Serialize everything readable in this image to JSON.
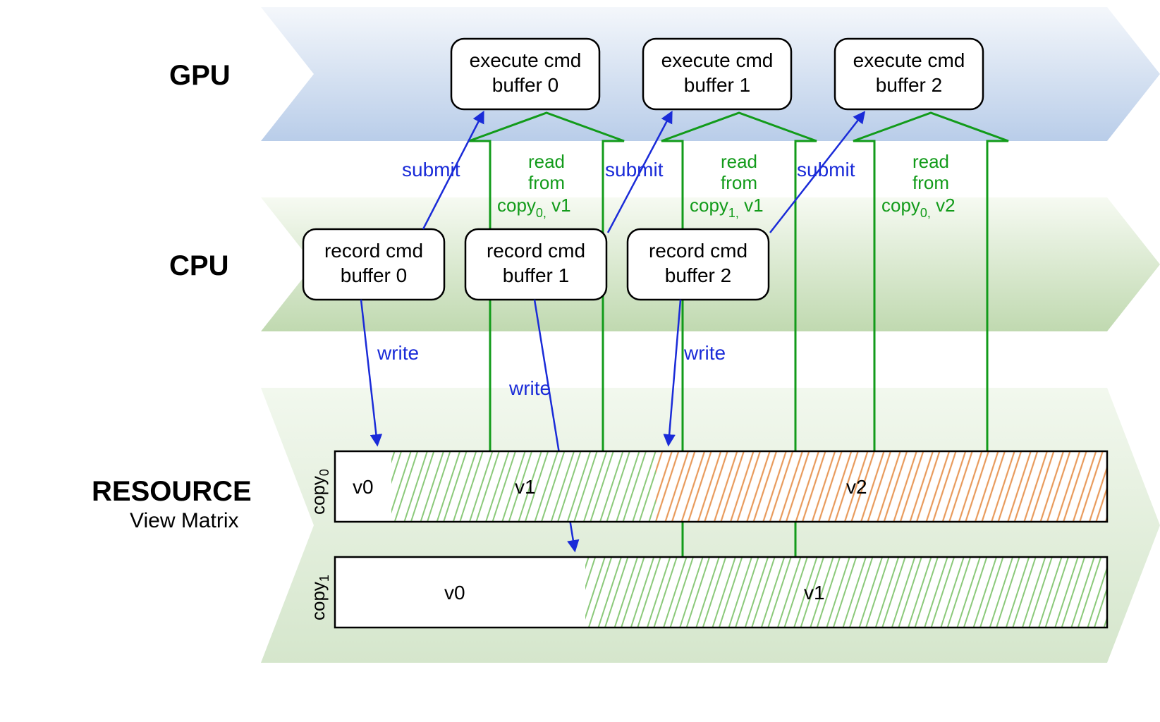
{
  "rows": {
    "gpu": "GPU",
    "cpu": "CPU",
    "resource": "RESOURCE",
    "resource_sub": "View Matrix"
  },
  "gpu_boxes": {
    "b0": {
      "l1": "execute cmd",
      "l2": "buffer 0"
    },
    "b1": {
      "l1": "execute cmd",
      "l2": "buffer 1"
    },
    "b2": {
      "l1": "execute cmd",
      "l2": "buffer 2"
    }
  },
  "cpu_boxes": {
    "b0": {
      "l1": "record cmd",
      "l2": "buffer 0"
    },
    "b1": {
      "l1": "record cmd",
      "l2": "buffer 1"
    },
    "b2": {
      "l1": "record cmd",
      "l2": "buffer 2"
    }
  },
  "annotations": {
    "submit": "submit",
    "write": "write",
    "read0": {
      "l1": "read",
      "l2": "from",
      "l3a": "copy",
      "l3sub": "0,",
      "l3b": " v1"
    },
    "read1": {
      "l1": "read",
      "l2": "from",
      "l3a": "copy",
      "l3sub": "1,",
      "l3b": " v1"
    },
    "read2": {
      "l1": "read",
      "l2": "from",
      "l3a": "copy",
      "l3sub": "0,",
      "l3b": " v2"
    }
  },
  "copies": {
    "c0": {
      "label": "copy",
      "sub": "0",
      "versions": [
        "v0",
        "v1",
        "v2"
      ]
    },
    "c1": {
      "label": "copy",
      "sub": "1",
      "versions": [
        "v0",
        "v1"
      ]
    }
  },
  "colors": {
    "gpu_band_top": "#d8e3f2",
    "gpu_band_bot": "#b9cde9",
    "cpu_band_top": "#e6f0e0",
    "cpu_band_bot": "#c0d9b0",
    "res_band": "#d5e6cc",
    "box_stroke": "#000000",
    "arrow_blue": "#1a2bd8",
    "arrow_green": "#129b1a",
    "hatch_green": "#8bc97a",
    "hatch_orange": "#e89a5b"
  }
}
